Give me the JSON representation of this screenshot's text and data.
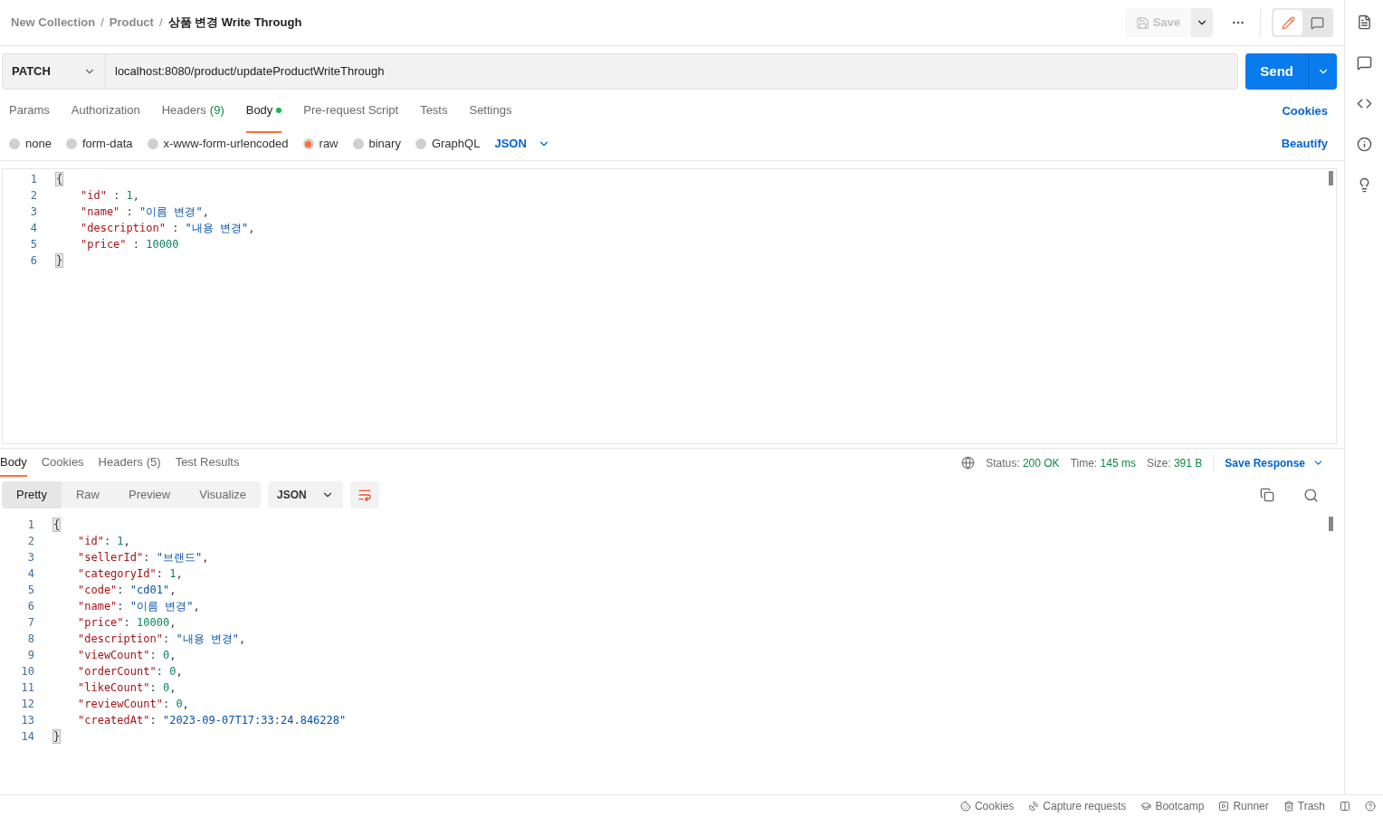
{
  "breadcrumb": {
    "items": [
      "New Collection",
      "Product"
    ],
    "separator": "/",
    "current": "상품 변경 Write Through"
  },
  "top_actions": {
    "save": {
      "label": "Save",
      "disabled": true
    },
    "modes": [
      {
        "kind": "edit",
        "selected": true
      },
      {
        "kind": "comment",
        "selected": false
      }
    ]
  },
  "request": {
    "method": "PATCH",
    "url": "localhost:8080/product/updateProductWriteThrough",
    "send": "Send"
  },
  "request_tabs": [
    {
      "label": "Params",
      "selected": false
    },
    {
      "label": "Authorization",
      "selected": false
    },
    {
      "label": "Headers",
      "count": "(9)",
      "selected": false
    },
    {
      "label": "Body",
      "dot": true,
      "selected": true
    },
    {
      "label": "Pre-request Script",
      "selected": false
    },
    {
      "label": "Tests",
      "selected": false
    },
    {
      "label": "Settings",
      "selected": false
    }
  ],
  "cookies_link": "Cookies",
  "body_types": [
    {
      "label": "none",
      "selected": false
    },
    {
      "label": "form-data",
      "selected": false
    },
    {
      "label": "x-www-form-urlencoded",
      "selected": false
    },
    {
      "label": "raw",
      "selected": true
    },
    {
      "label": "binary",
      "selected": false
    },
    {
      "label": "GraphQL",
      "selected": false
    }
  ],
  "body_format": "JSON",
  "beautify": "Beautify",
  "request_body": [
    {
      "number": "1",
      "kind": "brace",
      "text": "{"
    },
    {
      "number": "2",
      "kind": "number",
      "key": "\"id\"",
      "separator": " : ",
      "value": "1",
      "trailing": ","
    },
    {
      "number": "3",
      "kind": "string",
      "key": "\"name\"",
      "separator": " : ",
      "value": "\"이름 변경\"",
      "trailing": ","
    },
    {
      "number": "4",
      "kind": "string",
      "key": "\"description\"",
      "separator": " : ",
      "value": "\"내용 변경\"",
      "trailing": ","
    },
    {
      "number": "5",
      "kind": "number",
      "key": "\"price\"",
      "separator": " : ",
      "value": "10000"
    },
    {
      "number": "6",
      "kind": "brace",
      "text": "}"
    }
  ],
  "response_tabs": [
    {
      "label": "Body",
      "selected": true
    },
    {
      "label": "Cookies",
      "selected": false
    },
    {
      "label": "Headers",
      "count": "(5)",
      "selected": false
    },
    {
      "label": "Test Results",
      "selected": false
    }
  ],
  "response_meta": [
    {
      "label": "Status:",
      "value": "200 OK"
    },
    {
      "label": "Time:",
      "value": "145 ms"
    },
    {
      "label": "Size:",
      "value": "391 B"
    }
  ],
  "save_response": "Save Response",
  "view_modes": [
    {
      "label": "Pretty",
      "selected": true
    },
    {
      "label": "Raw",
      "selected": false
    },
    {
      "label": "Preview",
      "selected": false
    },
    {
      "label": "Visualize",
      "selected": false
    }
  ],
  "response_format": "JSON",
  "response_body": [
    {
      "number": "1",
      "kind": "brace",
      "text": "{"
    },
    {
      "number": "2",
      "kind": "number",
      "key": "\"id\"",
      "separator": ": ",
      "value": "1",
      "trailing": ","
    },
    {
      "number": "3",
      "kind": "string",
      "key": "\"sellerId\"",
      "separator": ": ",
      "value": "\"브랜드\"",
      "trailing": ","
    },
    {
      "number": "4",
      "kind": "number",
      "key": "\"categoryId\"",
      "separator": ": ",
      "value": "1",
      "trailing": ","
    },
    {
      "number": "5",
      "kind": "string",
      "key": "\"code\"",
      "separator": ": ",
      "value": "\"cd01\"",
      "trailing": ","
    },
    {
      "number": "6",
      "kind": "string",
      "key": "\"name\"",
      "separator": ": ",
      "value": "\"이름 변경\"",
      "trailing": ","
    },
    {
      "number": "7",
      "kind": "number",
      "key": "\"price\"",
      "separator": ": ",
      "value": "10000",
      "trailing": ","
    },
    {
      "number": "8",
      "kind": "string",
      "key": "\"description\"",
      "separator": ": ",
      "value": "\"내용 변경\"",
      "trailing": ","
    },
    {
      "number": "9",
      "kind": "number",
      "key": "\"viewCount\"",
      "separator": ": ",
      "value": "0",
      "trailing": ","
    },
    {
      "number": "10",
      "kind": "number",
      "key": "\"orderCount\"",
      "separator": ": ",
      "value": "0",
      "trailing": ","
    },
    {
      "number": "11",
      "kind": "number",
      "key": "\"likeCount\"",
      "separator": ": ",
      "value": "0",
      "trailing": ","
    },
    {
      "number": "12",
      "kind": "number",
      "key": "\"reviewCount\"",
      "separator": ": ",
      "value": "0",
      "trailing": ","
    },
    {
      "number": "13",
      "kind": "string",
      "key": "\"createdAt\"",
      "separator": ": ",
      "value": "\"2023-09-07T17:33:24.846228\""
    },
    {
      "number": "14",
      "kind": "brace",
      "text": "}"
    }
  ],
  "status_bar": [
    {
      "label": "Cookies"
    },
    {
      "label": "Capture requests"
    },
    {
      "label": "Bootcamp"
    },
    {
      "label": "Runner"
    },
    {
      "label": "Trash"
    }
  ]
}
